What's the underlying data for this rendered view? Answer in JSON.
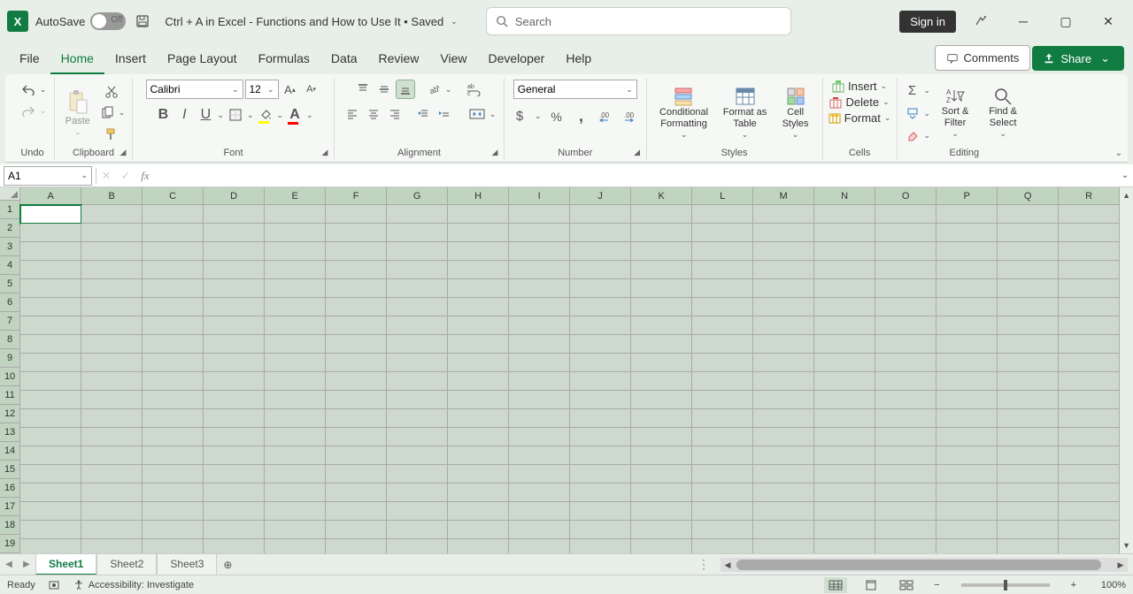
{
  "titlebar": {
    "autosave_label": "AutoSave",
    "autosave_state": "Off",
    "doc_title": "Ctrl + A in Excel - Functions and How to Use It • Saved",
    "search_placeholder": "Search",
    "signin": "Sign in"
  },
  "tabs": {
    "items": [
      "File",
      "Home",
      "Insert",
      "Page Layout",
      "Formulas",
      "Data",
      "Review",
      "View",
      "Developer",
      "Help"
    ],
    "active": "Home",
    "comments": "Comments",
    "share": "Share"
  },
  "ribbon": {
    "undo": {
      "label": "Undo"
    },
    "clipboard": {
      "label": "Clipboard",
      "paste": "Paste"
    },
    "font": {
      "label": "Font",
      "name": "Calibri",
      "size": "12",
      "fill_color": "#ffff00",
      "font_color": "#ff0000"
    },
    "alignment": {
      "label": "Alignment"
    },
    "number": {
      "label": "Number",
      "format": "General"
    },
    "styles": {
      "label": "Styles",
      "conditional": "Conditional Formatting",
      "table": "Format as Table",
      "cell": "Cell Styles"
    },
    "cells": {
      "label": "Cells",
      "insert": "Insert",
      "delete": "Delete",
      "format": "Format"
    },
    "editing": {
      "label": "Editing",
      "sort": "Sort & Filter",
      "find": "Find & Select"
    }
  },
  "formula_bar": {
    "name_box": "A1",
    "formula": ""
  },
  "grid": {
    "columns": [
      "A",
      "B",
      "C",
      "D",
      "E",
      "F",
      "G",
      "H",
      "I",
      "J",
      "K",
      "L",
      "M",
      "N",
      "O",
      "P",
      "Q",
      "R"
    ],
    "rows": [
      1,
      2,
      3,
      4,
      5,
      6,
      7,
      8,
      9,
      10,
      11,
      12,
      13,
      14,
      15,
      16,
      17,
      18,
      19
    ],
    "active_cell": "A1"
  },
  "sheets": {
    "tabs": [
      "Sheet1",
      "Sheet2",
      "Sheet3"
    ],
    "active": "Sheet1"
  },
  "statusbar": {
    "mode": "Ready",
    "accessibility": "Accessibility: Investigate",
    "zoom": "100%"
  }
}
